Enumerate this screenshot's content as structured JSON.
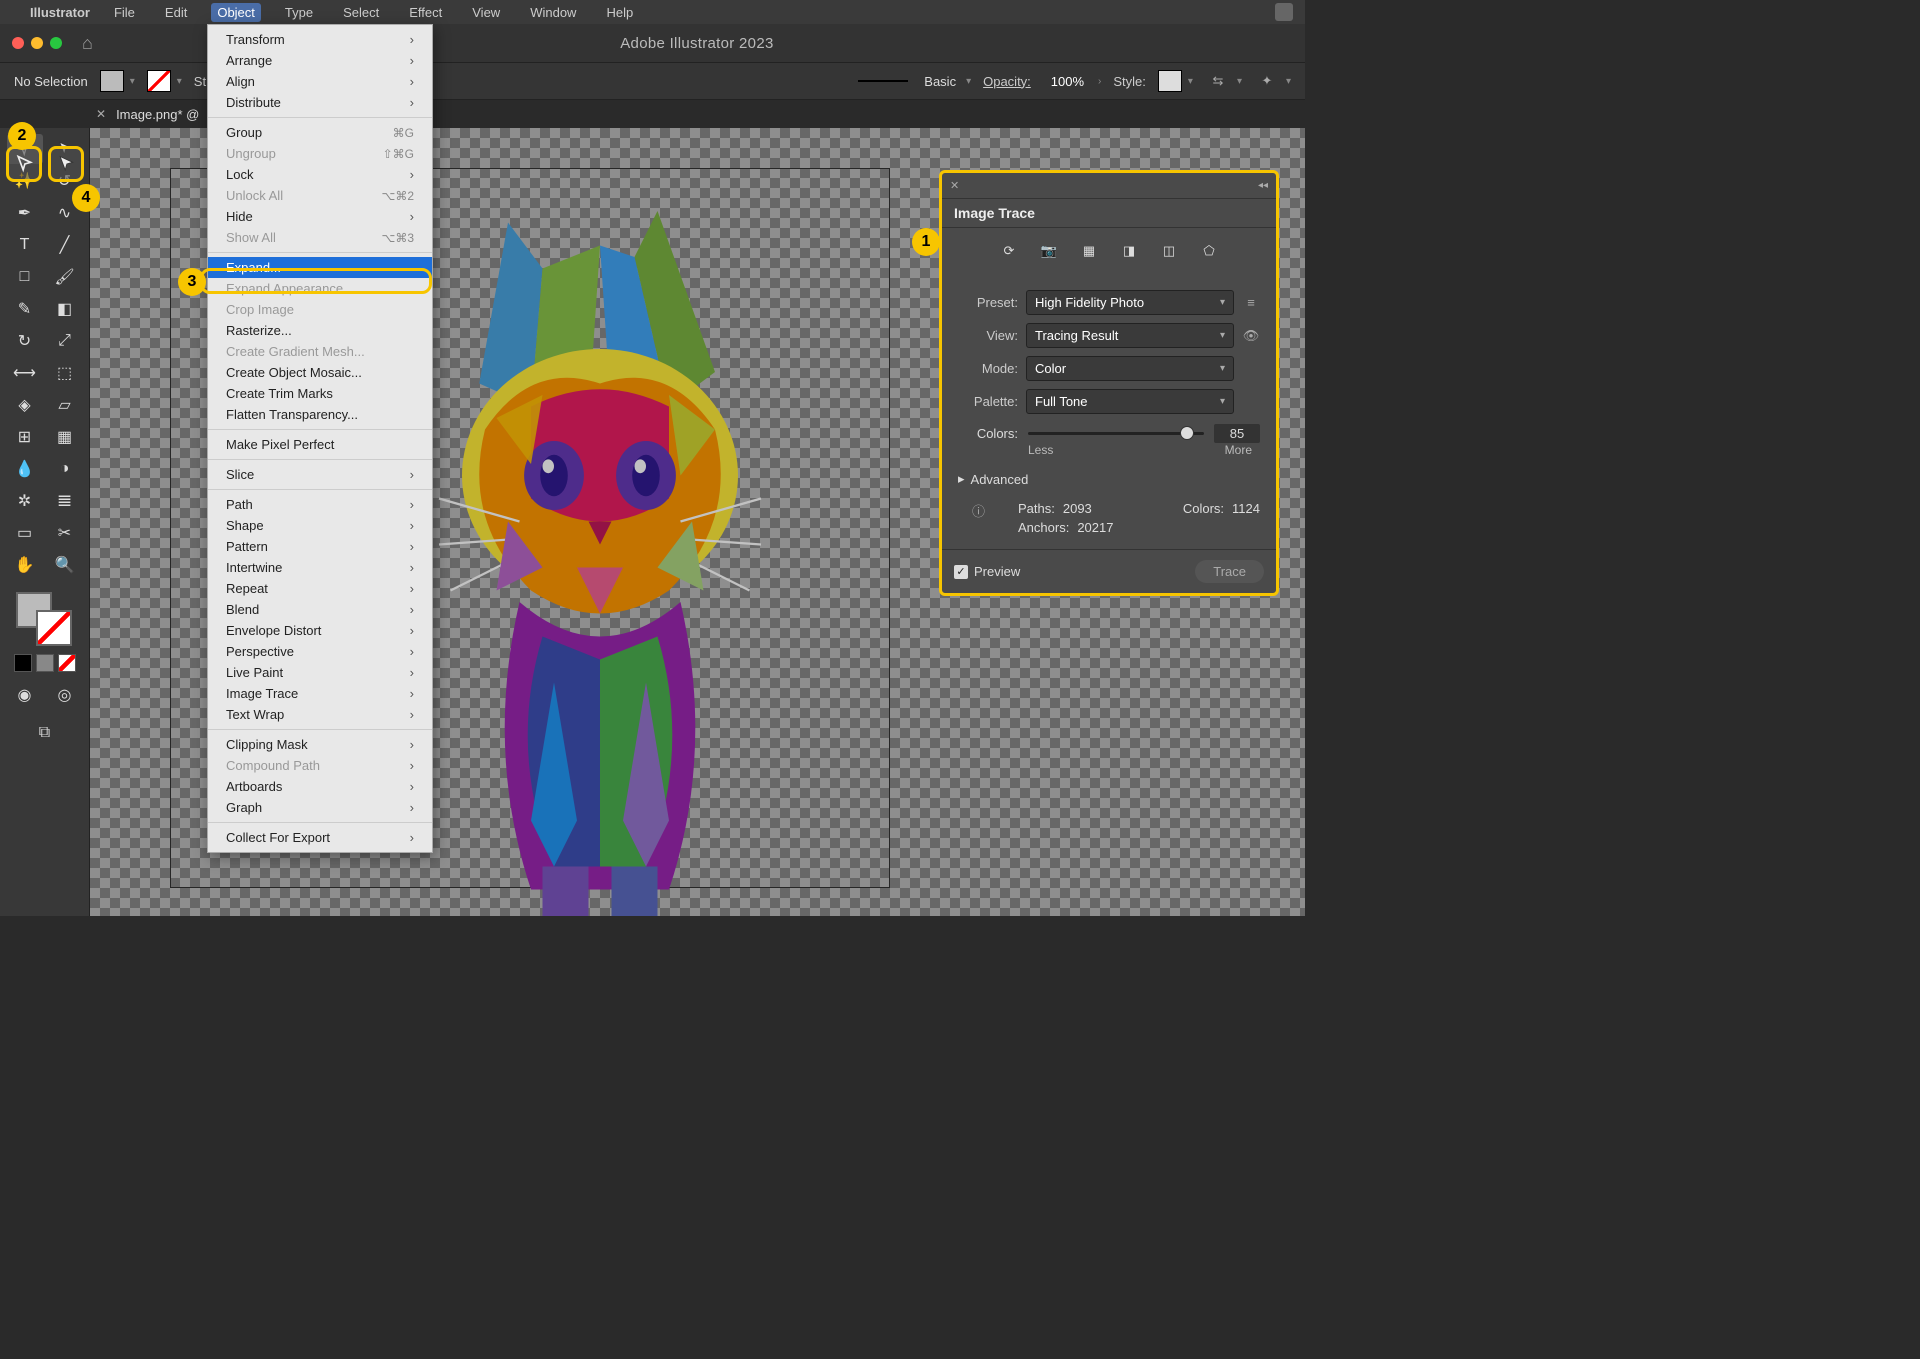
{
  "menubar": {
    "apple": "",
    "app": "Illustrator",
    "items": [
      "File",
      "Edit",
      "Object",
      "Type",
      "Select",
      "Effect",
      "View",
      "Window",
      "Help"
    ],
    "active": "Object"
  },
  "window": {
    "title": "Adobe Illustrator 2023"
  },
  "options": {
    "selection": "No Selection",
    "stroke_label": "Stroke:",
    "style_basic": "Basic",
    "opacity_label": "Opacity:",
    "opacity_value": "100%",
    "style_label": "Style:"
  },
  "tab": {
    "label": "Image.png* @"
  },
  "dropdown": {
    "items": [
      {
        "label": "Transform",
        "sub": true
      },
      {
        "label": "Arrange",
        "sub": true
      },
      {
        "label": "Align",
        "sub": true
      },
      {
        "label": "Distribute",
        "sub": true
      },
      {
        "sep": true
      },
      {
        "label": "Group",
        "shortcut": "⌘G"
      },
      {
        "label": "Ungroup",
        "shortcut": "⇧⌘G",
        "disabled": true
      },
      {
        "label": "Lock",
        "sub": true
      },
      {
        "label": "Unlock All",
        "shortcut": "⌥⌘2",
        "disabled": true
      },
      {
        "label": "Hide",
        "sub": true
      },
      {
        "label": "Show All",
        "shortcut": "⌥⌘3",
        "disabled": true
      },
      {
        "sep": true
      },
      {
        "label": "Expand...",
        "highlighted": true
      },
      {
        "label": "Expand Appearance",
        "disabled": true
      },
      {
        "label": "Crop Image",
        "disabled": true
      },
      {
        "label": "Rasterize..."
      },
      {
        "label": "Create Gradient Mesh...",
        "disabled": true
      },
      {
        "label": "Create Object Mosaic..."
      },
      {
        "label": "Create Trim Marks"
      },
      {
        "label": "Flatten Transparency..."
      },
      {
        "sep": true
      },
      {
        "label": "Make Pixel Perfect"
      },
      {
        "sep": true
      },
      {
        "label": "Slice",
        "sub": true
      },
      {
        "sep": true
      },
      {
        "label": "Path",
        "sub": true
      },
      {
        "label": "Shape",
        "sub": true
      },
      {
        "label": "Pattern",
        "sub": true
      },
      {
        "label": "Intertwine",
        "sub": true
      },
      {
        "label": "Repeat",
        "sub": true
      },
      {
        "label": "Blend",
        "sub": true
      },
      {
        "label": "Envelope Distort",
        "sub": true
      },
      {
        "label": "Perspective",
        "sub": true
      },
      {
        "label": "Live Paint",
        "sub": true
      },
      {
        "label": "Image Trace",
        "sub": true
      },
      {
        "label": "Text Wrap",
        "sub": true
      },
      {
        "sep": true
      },
      {
        "label": "Clipping Mask",
        "sub": true
      },
      {
        "label": "Compound Path",
        "sub": true,
        "disabled": true
      },
      {
        "label": "Artboards",
        "sub": true
      },
      {
        "label": "Graph",
        "sub": true
      },
      {
        "sep": true
      },
      {
        "label": "Collect For Export",
        "sub": true
      }
    ]
  },
  "image_trace": {
    "title": "Image Trace",
    "preset_label": "Preset:",
    "preset_value": "High Fidelity Photo",
    "view_label": "View:",
    "view_value": "Tracing Result",
    "mode_label": "Mode:",
    "mode_value": "Color",
    "palette_label": "Palette:",
    "palette_value": "Full Tone",
    "colors_label": "Colors:",
    "colors_value": "85",
    "less": "Less",
    "more": "More",
    "advanced": "Advanced",
    "paths_label": "Paths:",
    "paths_value": "2093",
    "colors_stat_label": "Colors:",
    "colors_stat_value": "1124",
    "anchors_label": "Anchors:",
    "anchors_value": "20217",
    "preview": "Preview",
    "trace": "Trace"
  },
  "callouts": {
    "c1": "1",
    "c2": "2",
    "c3": "3",
    "c4": "4"
  }
}
